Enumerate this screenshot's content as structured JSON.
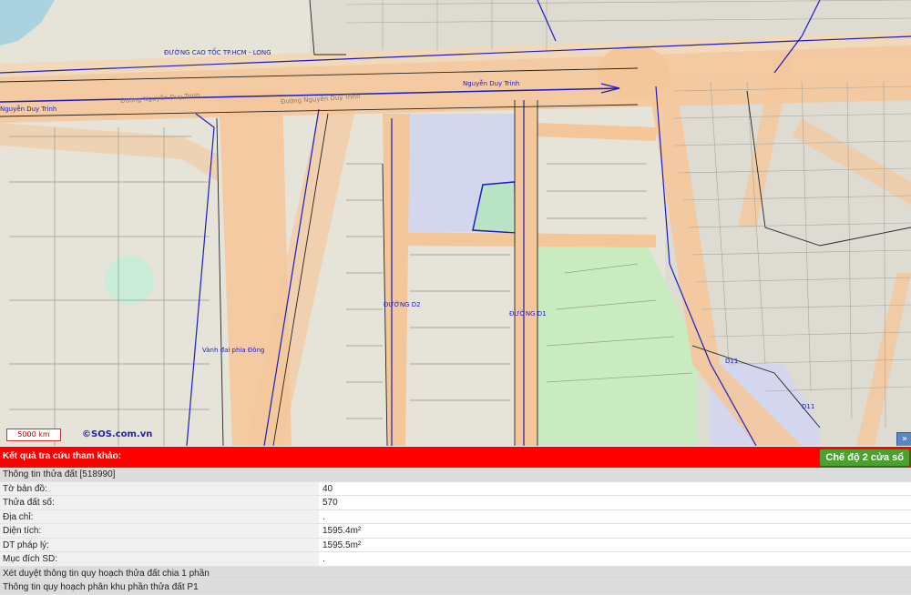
{
  "map": {
    "road_labels": {
      "expressway": "ĐƯỜNG CAO TỐC TP.HCM - LONG",
      "nguyen_duy_trinh_top": "Nguyễn Duy Trinh",
      "nguyen_duy_trinh_left": "Nguyễn Duy Trinh",
      "nguyen_duy_trinh_road1": "Đường Nguyễn Duy Trinh",
      "nguyen_duy_trinh_road2": "Đường Nguyễn Duy Trinh",
      "d2": "ĐƯỜNG D2",
      "d1": "ĐƯỜNG D1",
      "vanh_dai": "Vành đai phía Đông",
      "d11_a": "D11",
      "d11_b": "D11"
    },
    "scale_label": "5000 km",
    "copyright": "©SOS.com.vn",
    "expand_icon": "»"
  },
  "result": {
    "title": "Kết quả tra cứu tham khảo:",
    "mode_button": "Chế độ 2 cửa sổ"
  },
  "info": {
    "parcel_header": "Thông tin thửa đất [518990]",
    "rows": [
      {
        "label": "Tờ bản đồ:",
        "value": "40"
      },
      {
        "label": "Thửa đất số:",
        "value": "570"
      },
      {
        "label": "Địa chỉ:",
        "value": "."
      },
      {
        "label": "Diện tích:",
        "value": "1595.4m²"
      },
      {
        "label": "DT pháp lý:",
        "value": "1595.5m²"
      },
      {
        "label": "Mục đích SD:",
        "value": "."
      }
    ],
    "section_1": "Xét duyệt thông tin quy hoạch thửa đất chia 1 phần",
    "section_2": "Thông tin quy hoạch phân khu phần thửa đất P1"
  },
  "colors": {
    "road_fill": "#f4c79b",
    "park_fill": "#c8ecc0",
    "public_fill": "#d4d6ee",
    "parcel_line": "#1c1cc0",
    "result_bar": "#ff0000",
    "mode_button": "#4aa12f"
  }
}
